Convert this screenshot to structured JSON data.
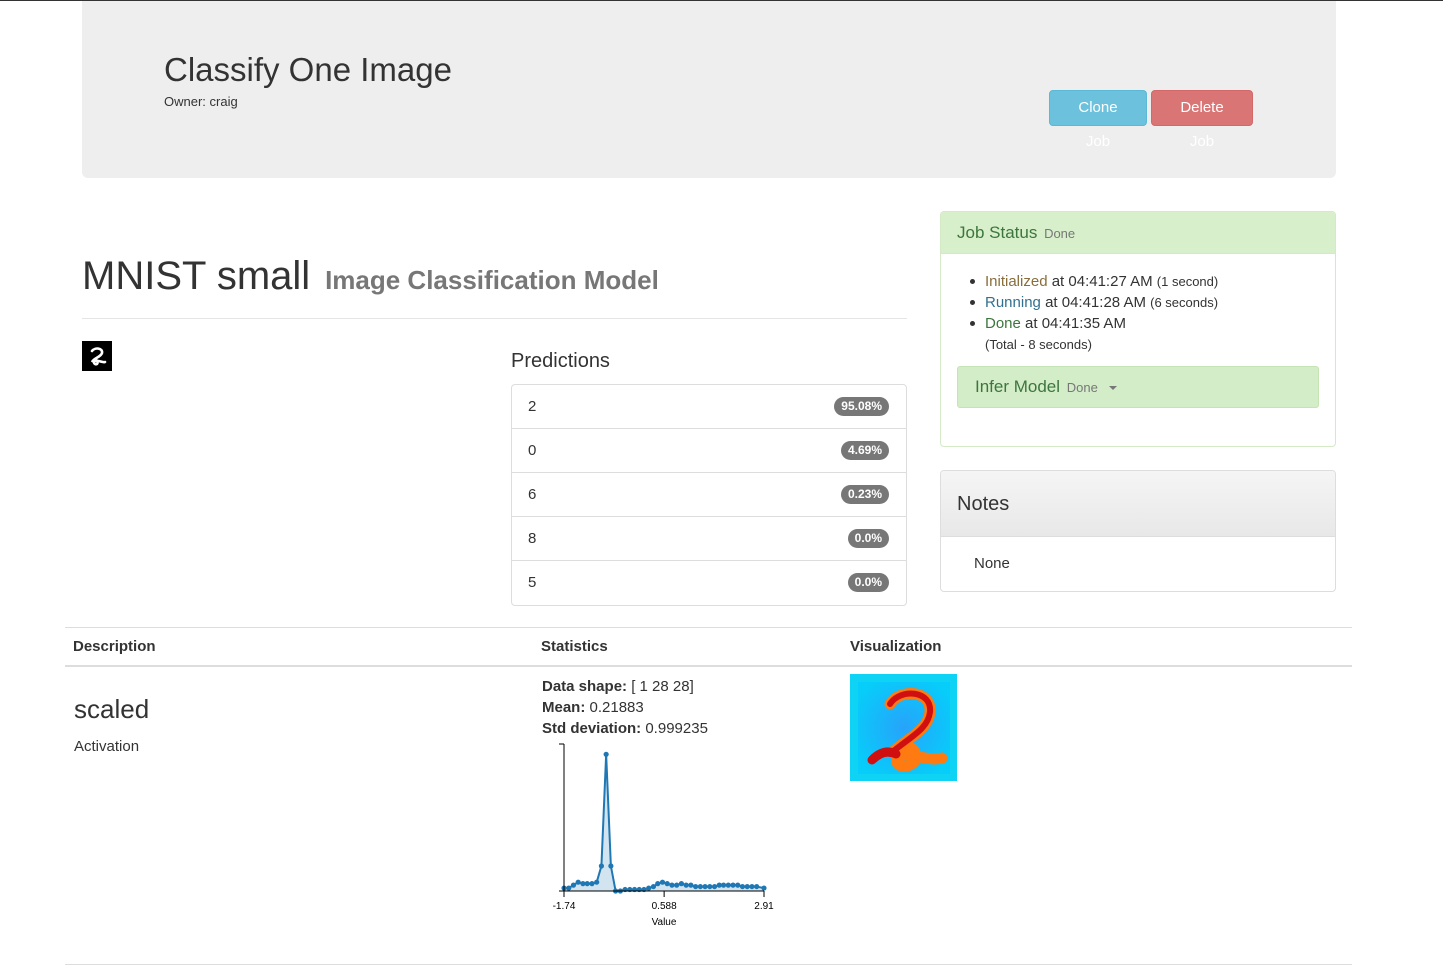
{
  "job": {
    "title": "Classify One Image",
    "owner_label": "Owner:",
    "owner": "craig",
    "clone_label": "Clone Job",
    "delete_label": "Delete Job"
  },
  "model": {
    "name": "MNIST small",
    "subtitle": "Image Classification Model"
  },
  "predictions": {
    "title": "Predictions",
    "items": [
      {
        "label": "2",
        "percent": "95.08%"
      },
      {
        "label": "0",
        "percent": "4.69%"
      },
      {
        "label": "6",
        "percent": "0.23%"
      },
      {
        "label": "8",
        "percent": "0.0%"
      },
      {
        "label": "5",
        "percent": "0.0%"
      }
    ]
  },
  "job_status": {
    "title": "Job Status",
    "state": "Done",
    "events": [
      {
        "status": "Initialized",
        "at": "at 04:41:27 AM",
        "duration": "(1 second)"
      },
      {
        "status": "Running",
        "at": "at 04:41:28 AM",
        "duration": "(6 seconds)"
      },
      {
        "status": "Done",
        "at": "at 04:41:35 AM",
        "duration": ""
      }
    ],
    "total": "(Total - 8 seconds)",
    "infer_label": "Infer Model",
    "infer_state": "Done"
  },
  "notes": {
    "title": "Notes",
    "body": "None"
  },
  "layers_table": {
    "headers": [
      "Description",
      "Statistics",
      "Visualization"
    ],
    "rows": [
      {
        "name": "scaled",
        "type": "Activation",
        "data_shape_label": "Data shape:",
        "data_shape": "[ 1 28 28]",
        "mean_label": "Mean:",
        "mean": "0.21883",
        "std_label": "Std deviation:",
        "std": "0.999235"
      }
    ]
  },
  "chart_data": {
    "type": "area",
    "xlabel": "Value",
    "x_ticks": [
      "-1.74",
      "0.588",
      "2.91"
    ],
    "xlim": [
      -1.74,
      2.91
    ],
    "ylim": [
      0,
      1
    ],
    "grid": false,
    "color": "#1f77b4",
    "x": [
      -1.74,
      -1.63,
      -1.52,
      -1.41,
      -1.3,
      -1.2,
      -1.09,
      -0.98,
      -0.87,
      -0.76,
      -0.65,
      -0.54,
      -0.43,
      -0.32,
      -0.21,
      -0.1,
      0.01,
      0.12,
      0.23,
      0.34,
      0.44,
      0.55,
      0.66,
      0.77,
      0.88,
      0.99,
      1.1,
      1.21,
      1.32,
      1.43,
      1.54,
      1.65,
      1.76,
      1.87,
      1.97,
      2.08,
      2.19,
      2.3,
      2.41,
      2.52,
      2.63,
      2.74,
      2.91
    ],
    "values": [
      0.02,
      0.02,
      0.04,
      0.06,
      0.05,
      0.05,
      0.05,
      0.06,
      0.17,
      0.93,
      0.17,
      0.0,
      0.0,
      0.01,
      0.01,
      0.01,
      0.01,
      0.01,
      0.02,
      0.03,
      0.05,
      0.06,
      0.05,
      0.04,
      0.04,
      0.05,
      0.04,
      0.04,
      0.03,
      0.03,
      0.03,
      0.03,
      0.03,
      0.04,
      0.04,
      0.04,
      0.04,
      0.04,
      0.03,
      0.03,
      0.03,
      0.03,
      0.02
    ]
  },
  "colors": {
    "clone": "#6cc1dc",
    "delete": "#d97575",
    "status_green": "#3c763d",
    "status_running": "#31708f",
    "status_initialized": "#8a6d3b"
  }
}
